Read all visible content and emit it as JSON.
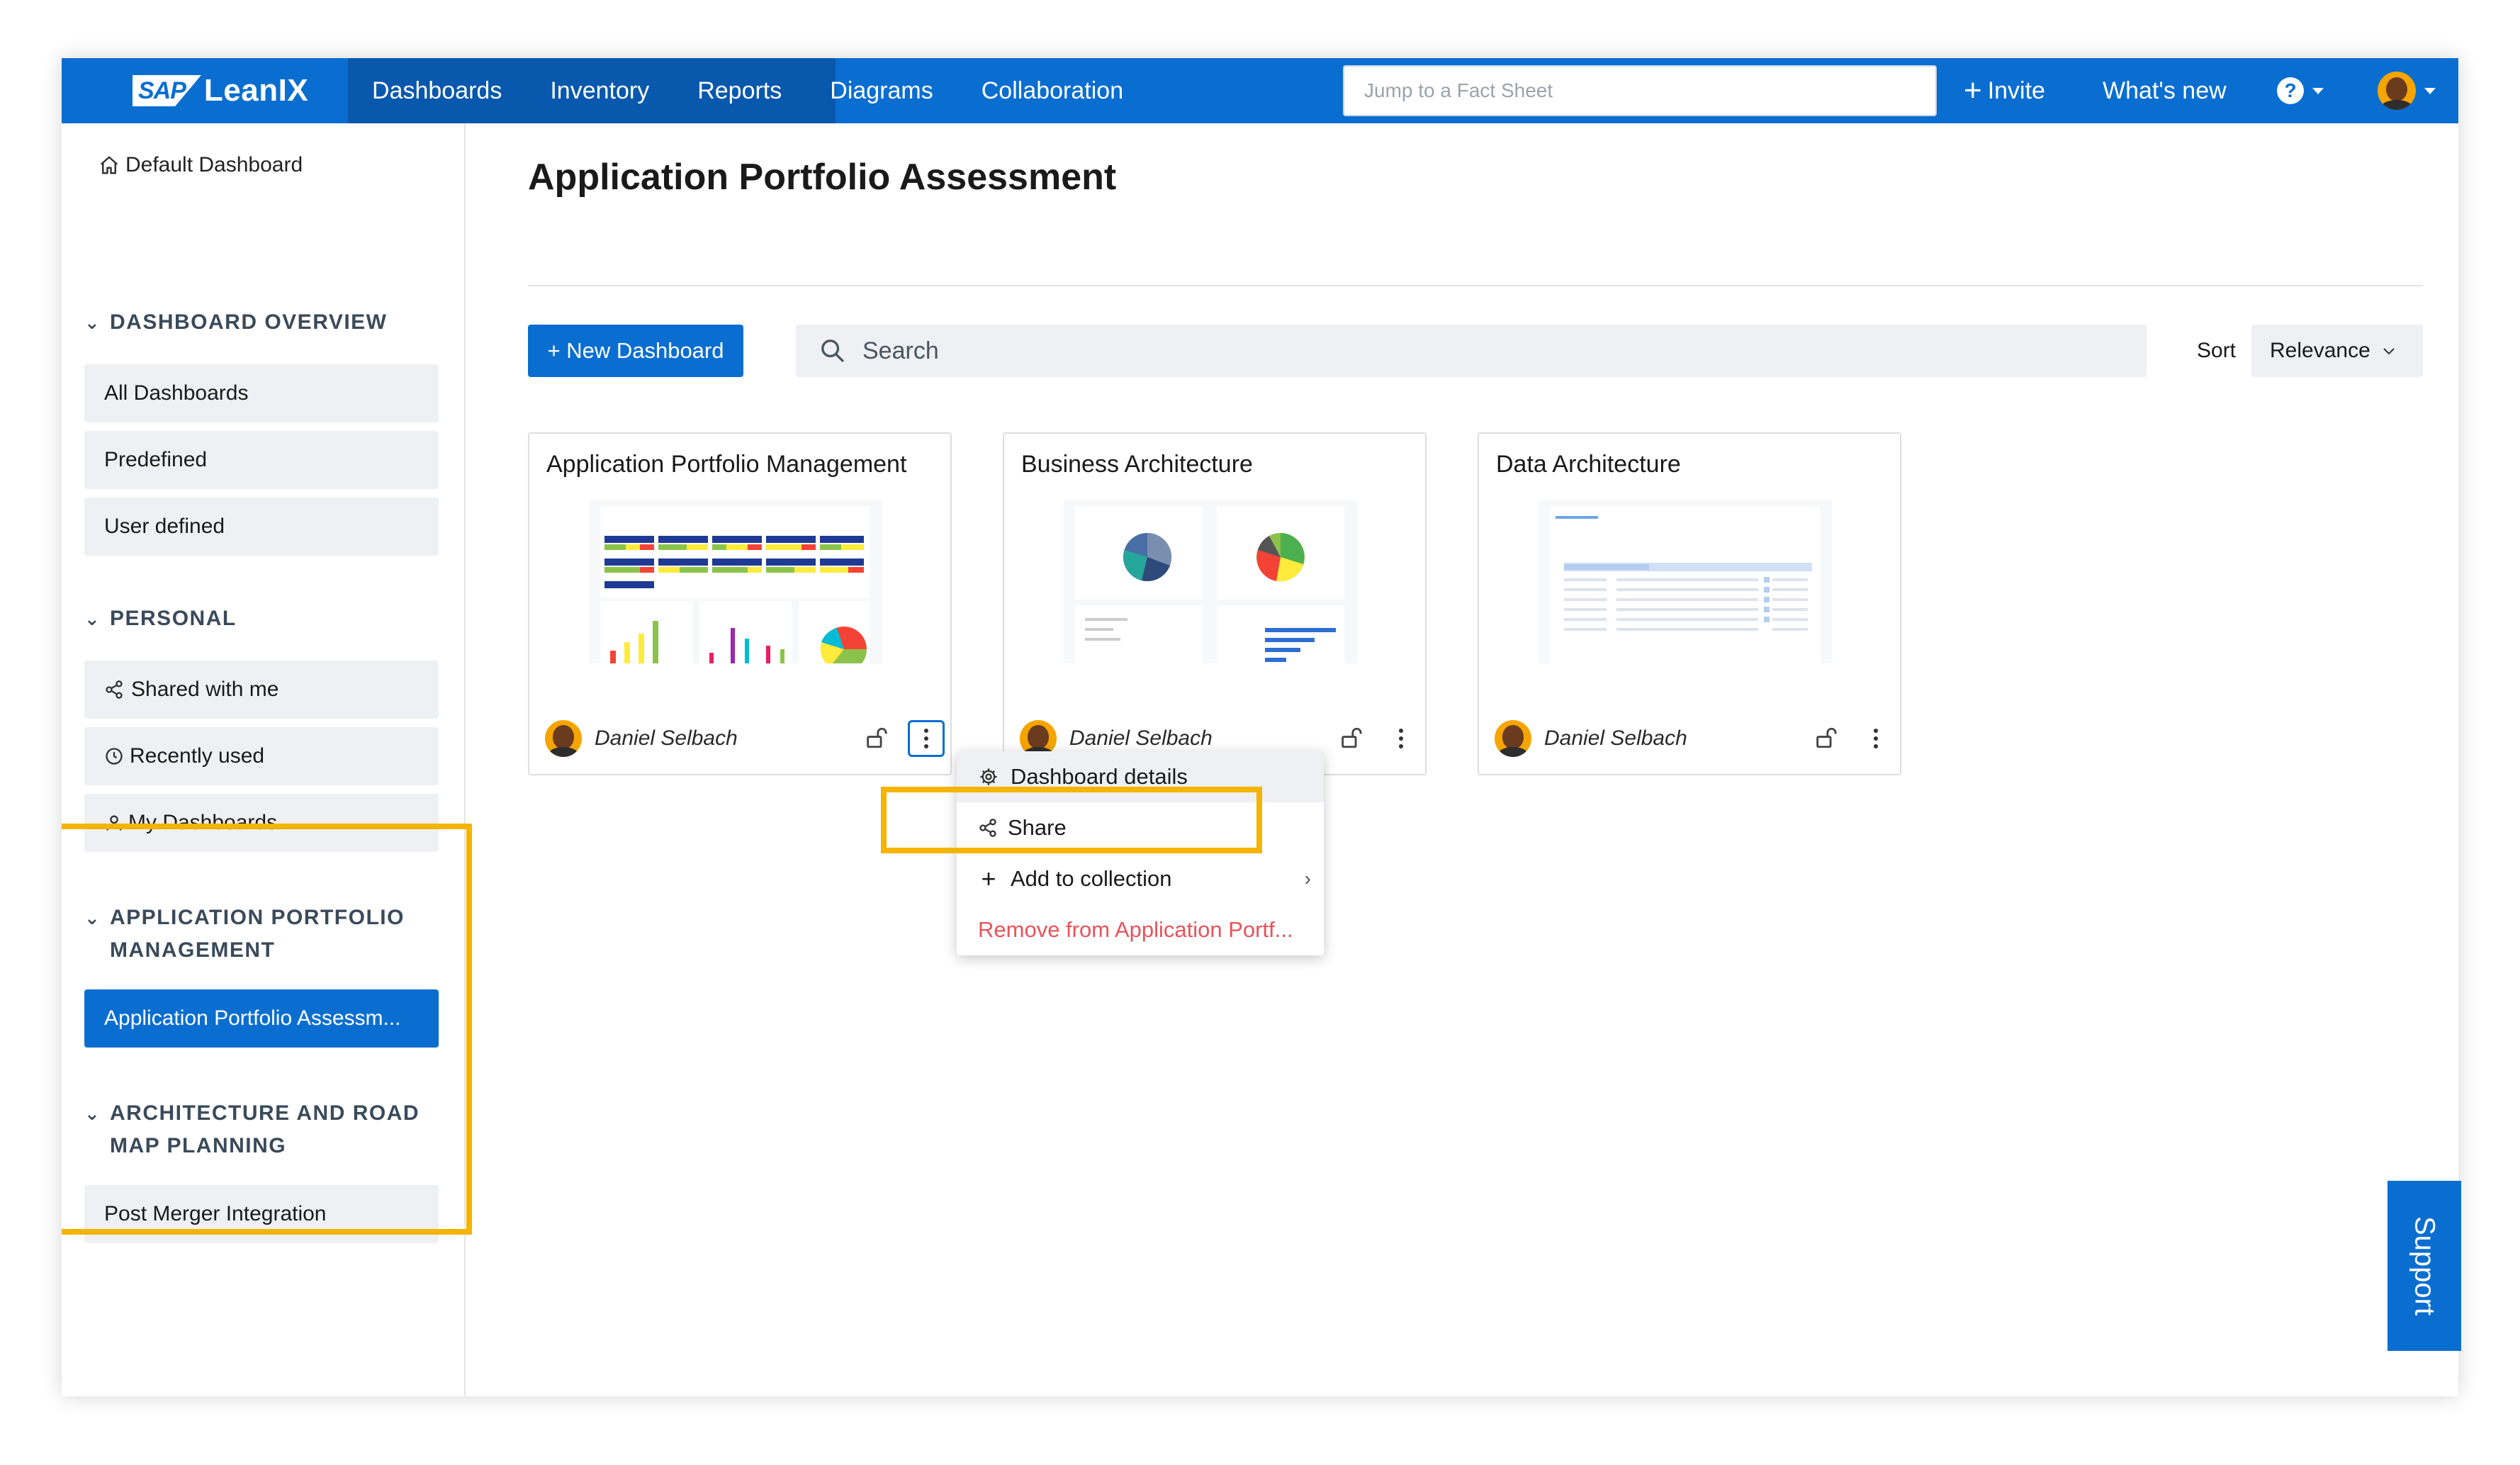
{
  "brand": {
    "sap": "SAP",
    "name": "LeanIX"
  },
  "nav": {
    "items": [
      "Dashboards",
      "Inventory",
      "Reports",
      "Diagrams",
      "Collaboration"
    ]
  },
  "header": {
    "search_placeholder": "Jump to a Fact Sheet",
    "invite_label": "Invite",
    "whats_new_label": "What's new",
    "help_label": "?"
  },
  "sidebar": {
    "default_dashboard": "Default Dashboard",
    "sections": [
      {
        "title": "DASHBOARD OVERVIEW",
        "items": [
          "All Dashboards",
          "Predefined",
          "User defined"
        ]
      },
      {
        "title": "PERSONAL",
        "items": [
          "Shared with me",
          "Recently used",
          "My Dashboards"
        ]
      },
      {
        "title": "APPLICATION PORTFOLIO MANAGEMENT",
        "title_lines": [
          "APPLICATION PORTFOLIO",
          "MANAGEMENT"
        ],
        "items": [
          "Application Portfolio Assessm..."
        ]
      },
      {
        "title": "ARCHITECTURE AND ROAD MAP PLANNING",
        "title_lines": [
          "ARCHITECTURE AND ROAD",
          "MAP PLANNING"
        ],
        "items": [
          "Post Merger Integration"
        ]
      }
    ]
  },
  "main": {
    "title": "Application Portfolio Assessment",
    "new_button": "New Dashboard",
    "search_placeholder": "Search",
    "sort_label": "Sort",
    "sort_value": "Relevance"
  },
  "cards": [
    {
      "title": "Application Portfolio Management",
      "owner": "Daniel Selbach"
    },
    {
      "title": "Business Architecture",
      "owner": "Daniel Selbach"
    },
    {
      "title": "Data Architecture",
      "owner": "Daniel Selbach"
    }
  ],
  "menu": {
    "items": [
      "Dashboard details",
      "Share",
      "Add to collection",
      "Remove from Application Portf..."
    ]
  },
  "support_label": "Support",
  "colors": {
    "primary": "#0a6ed1",
    "highlight": "#f5b400",
    "danger": "#e9525a"
  }
}
